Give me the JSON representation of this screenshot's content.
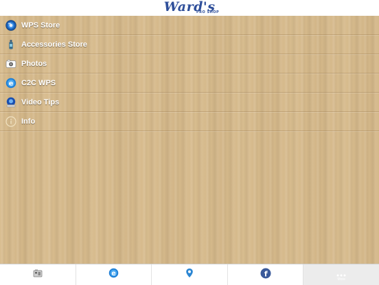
{
  "header": {
    "logo_text": "Ward's",
    "logo_subtext": "PRO SHOP"
  },
  "menu": {
    "items": [
      {
        "label": "WPS Store",
        "icon": "globe-icon"
      },
      {
        "label": "Accessories Store",
        "icon": "bottle-icon"
      },
      {
        "label": "Photos",
        "icon": "camera-icon"
      },
      {
        "label": "C2C WPS",
        "icon": "ie-icon"
      },
      {
        "label": "Video Tips",
        "icon": "video-icon"
      },
      {
        "label": "Info",
        "icon": "info-icon"
      }
    ]
  },
  "tabbar": {
    "tabs": [
      {
        "icon": "gallery-icon"
      },
      {
        "icon": "ie-icon"
      },
      {
        "icon": "map-pin-icon"
      },
      {
        "icon": "facebook-icon"
      },
      {
        "icon": "more-icon",
        "label": "More"
      }
    ]
  },
  "colors": {
    "wood": "#d8bc8e",
    "logo_blue": "#2f4f9a",
    "icon_blue": "#1a5fb4"
  }
}
